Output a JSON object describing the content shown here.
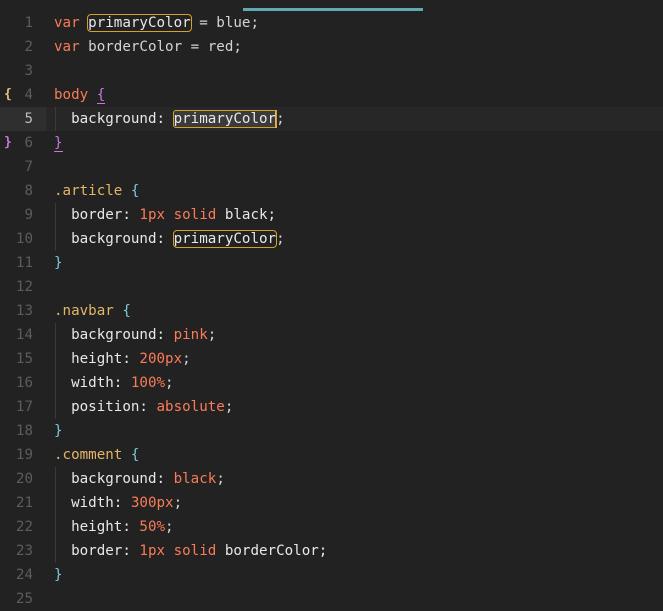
{
  "editor": {
    "lines": [
      {
        "n": "1",
        "tokens": [
          [
            "var",
            "kw"
          ],
          [
            " ",
            "plain"
          ],
          [
            "primaryColor",
            "var"
          ],
          [
            " = blue;",
            "op"
          ]
        ]
      },
      {
        "n": "2",
        "tokens": [
          [
            "var",
            "kw"
          ],
          [
            " borderColor = red;",
            "op"
          ]
        ]
      },
      {
        "n": "3",
        "tokens": []
      },
      {
        "n": "4",
        "tokens": [
          [
            "body",
            "kw"
          ],
          [
            " ",
            "plain"
          ],
          [
            "{",
            "brace"
          ]
        ]
      },
      {
        "n": "5",
        "tokens": [
          [
            "  background: ",
            "prop"
          ],
          [
            "primaryColor",
            "var"
          ],
          [
            ";",
            "punct"
          ]
        ]
      },
      {
        "n": "6",
        "tokens": [
          [
            "}",
            "brace"
          ]
        ]
      },
      {
        "n": "7",
        "tokens": []
      },
      {
        "n": "8",
        "tokens": [
          [
            ".article",
            "sel"
          ],
          [
            " ",
            "plain"
          ],
          [
            "{",
            "brace"
          ]
        ]
      },
      {
        "n": "9",
        "tokens": [
          [
            "  border: ",
            "prop"
          ],
          [
            "1px solid",
            "val"
          ],
          [
            " black;",
            "plain"
          ]
        ]
      },
      {
        "n": "10",
        "tokens": [
          [
            "  background: ",
            "prop"
          ],
          [
            "primaryColor",
            "var"
          ],
          [
            ";",
            "punct"
          ]
        ]
      },
      {
        "n": "11",
        "tokens": [
          [
            "}",
            "brace"
          ]
        ]
      },
      {
        "n": "12",
        "tokens": []
      },
      {
        "n": "13",
        "tokens": [
          [
            ".navbar",
            "sel"
          ],
          [
            " ",
            "plain"
          ],
          [
            "{",
            "brace"
          ]
        ]
      },
      {
        "n": "14",
        "tokens": [
          [
            "  background: ",
            "prop"
          ],
          [
            "pink",
            "val"
          ],
          [
            ";",
            "punct"
          ]
        ]
      },
      {
        "n": "15",
        "tokens": [
          [
            "  height: ",
            "prop"
          ],
          [
            "200px",
            "val"
          ],
          [
            ";",
            "punct"
          ]
        ]
      },
      {
        "n": "16",
        "tokens": [
          [
            "  width: ",
            "prop"
          ],
          [
            "100%",
            "val"
          ],
          [
            ";",
            "punct"
          ]
        ]
      },
      {
        "n": "17",
        "tokens": [
          [
            "  position: ",
            "prop"
          ],
          [
            "absolute",
            "val"
          ],
          [
            ";",
            "punct"
          ]
        ]
      },
      {
        "n": "18",
        "tokens": [
          [
            "}",
            "brace"
          ]
        ]
      },
      {
        "n": "19",
        "tokens": [
          [
            ".comment",
            "sel"
          ],
          [
            " ",
            "plain"
          ],
          [
            "{",
            "brace"
          ]
        ]
      },
      {
        "n": "20",
        "tokens": [
          [
            "  background: ",
            "prop"
          ],
          [
            "black",
            "val"
          ],
          [
            ";",
            "punct"
          ]
        ]
      },
      {
        "n": "21",
        "tokens": [
          [
            "  width: ",
            "prop"
          ],
          [
            "300px",
            "val"
          ],
          [
            ";",
            "punct"
          ]
        ]
      },
      {
        "n": "22",
        "tokens": [
          [
            "  height: ",
            "prop"
          ],
          [
            "50%",
            "val"
          ],
          [
            ";",
            "punct"
          ]
        ]
      },
      {
        "n": "23",
        "tokens": [
          [
            "  border: ",
            "prop"
          ],
          [
            "1px solid",
            "val"
          ],
          [
            " borderColor;",
            "plain"
          ]
        ]
      },
      {
        "n": "24",
        "tokens": [
          [
            "}",
            "brace"
          ]
        ]
      },
      {
        "n": "25",
        "tokens": []
      }
    ],
    "fold_markers": {
      "4": "{",
      "6": "}"
    },
    "current_line": "5",
    "colors": {
      "background": "#222222",
      "keyword": "#f97b58",
      "selector": "#e5b567",
      "brace": "#7fc9d8",
      "highlight_outline": "#d4a22a",
      "tab_indicator": "#5fa8b4"
    }
  }
}
